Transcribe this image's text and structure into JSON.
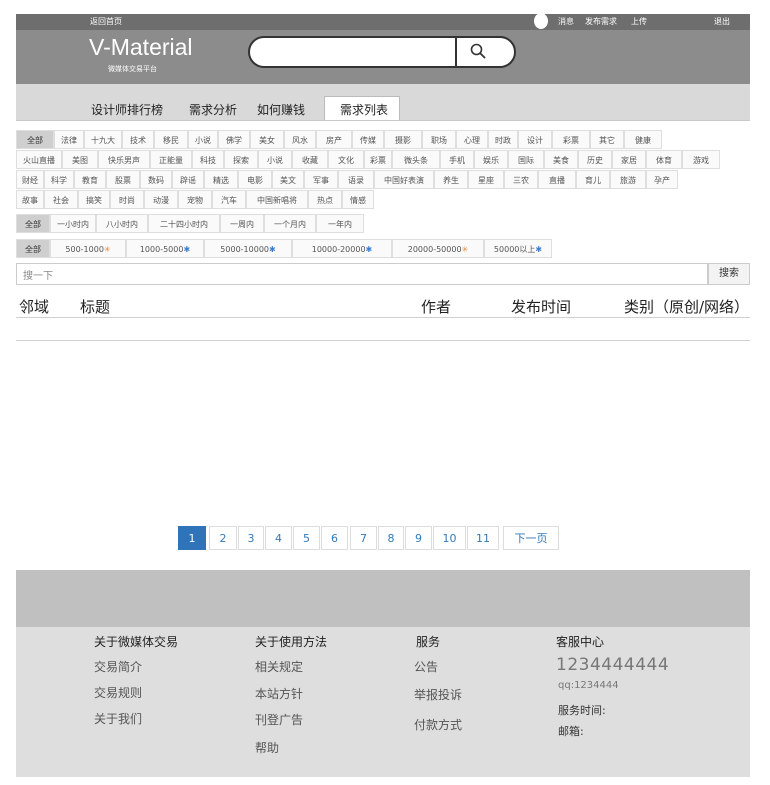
{
  "topbar": {
    "home_link": "返回首页",
    "messages": "消息",
    "post_demand": "发布需求",
    "upload": "上传",
    "logout": "退出"
  },
  "brand": {
    "logo": "V-Material",
    "subtitle": "微媒体交易平台"
  },
  "search_bar": {
    "icon": "magnifier-icon"
  },
  "nav": {
    "items": [
      "设计师排行榜",
      "需求分析",
      "如何赚钱",
      "需求列表"
    ],
    "active": "需求列表"
  },
  "filters": {
    "category_row1": [
      "全部",
      "法律",
      "十九大",
      "技术",
      "移民",
      "小说",
      "佛学",
      "美女",
      "风水",
      "房产",
      "传媒",
      "摄影",
      "职场",
      "心理",
      "时政",
      "设计",
      "彩票",
      "其它",
      "健康"
    ],
    "category_row2": [
      "火山直播",
      "美图",
      "快乐男声",
      "正能量",
      "科技",
      "探索",
      "小说",
      "收藏",
      "文化",
      "彩票",
      "微头条",
      "手机",
      "娱乐",
      "国际",
      "美食",
      "历史",
      "家居",
      "体育",
      "游戏"
    ],
    "category_row3": [
      "财经",
      "科学",
      "教育",
      "股票",
      "数码",
      "辟谣",
      "精选",
      "电影",
      "美文",
      "军事",
      "语录",
      "中国好表演",
      "养生",
      "星座",
      "三农",
      "直播",
      "育儿",
      "旅游",
      "孕产"
    ],
    "category_row4": [
      "故事",
      "社会",
      "搞笑",
      "时尚",
      "动漫",
      "宠物",
      "汽车",
      "中国新唱将",
      "热点",
      "情感"
    ],
    "time_row": [
      "全部",
      "一小时内",
      "八小时内",
      "二十四小时内",
      "一周内",
      "一个月内",
      "一年内"
    ],
    "price_row": [
      {
        "label": "全部",
        "star": ""
      },
      {
        "label": "500-1000",
        "star": "✳"
      },
      {
        "label": "1000-5000",
        "star": "✱"
      },
      {
        "label": "5000-10000",
        "star": "✱"
      },
      {
        "label": "10000-20000",
        "star": "✱"
      },
      {
        "label": "20000-50000",
        "star": "✳"
      },
      {
        "label": "50000以上",
        "star": "✱"
      }
    ]
  },
  "query": {
    "placeholder": "搜一下",
    "button": "搜索"
  },
  "table": {
    "headers": [
      "邻域",
      "标题",
      "作者",
      "发布时间",
      "类别（原创/网络）"
    ]
  },
  "pagination": {
    "pages": [
      "1",
      "2",
      "3",
      "4",
      "5",
      "6",
      "7",
      "8",
      "9",
      "10",
      "11"
    ],
    "current": "1",
    "next": "下一页"
  },
  "footer": {
    "col1": {
      "title": "关于微媒体交易",
      "links": [
        "交易简介",
        "交易规则",
        "关于我们"
      ]
    },
    "col2": {
      "title": "关于使用方法",
      "links": [
        "相关规定",
        "本站方针",
        "刊登广告",
        "帮助"
      ]
    },
    "col3": {
      "title": "服务",
      "links": [
        "公告",
        "举报投诉",
        "付款方式"
      ]
    },
    "col4": {
      "title": "客服中心",
      "phone": "1234444444",
      "qq": "qq:1234444",
      "hours": "服务时间:",
      "email": "邮箱:"
    }
  }
}
